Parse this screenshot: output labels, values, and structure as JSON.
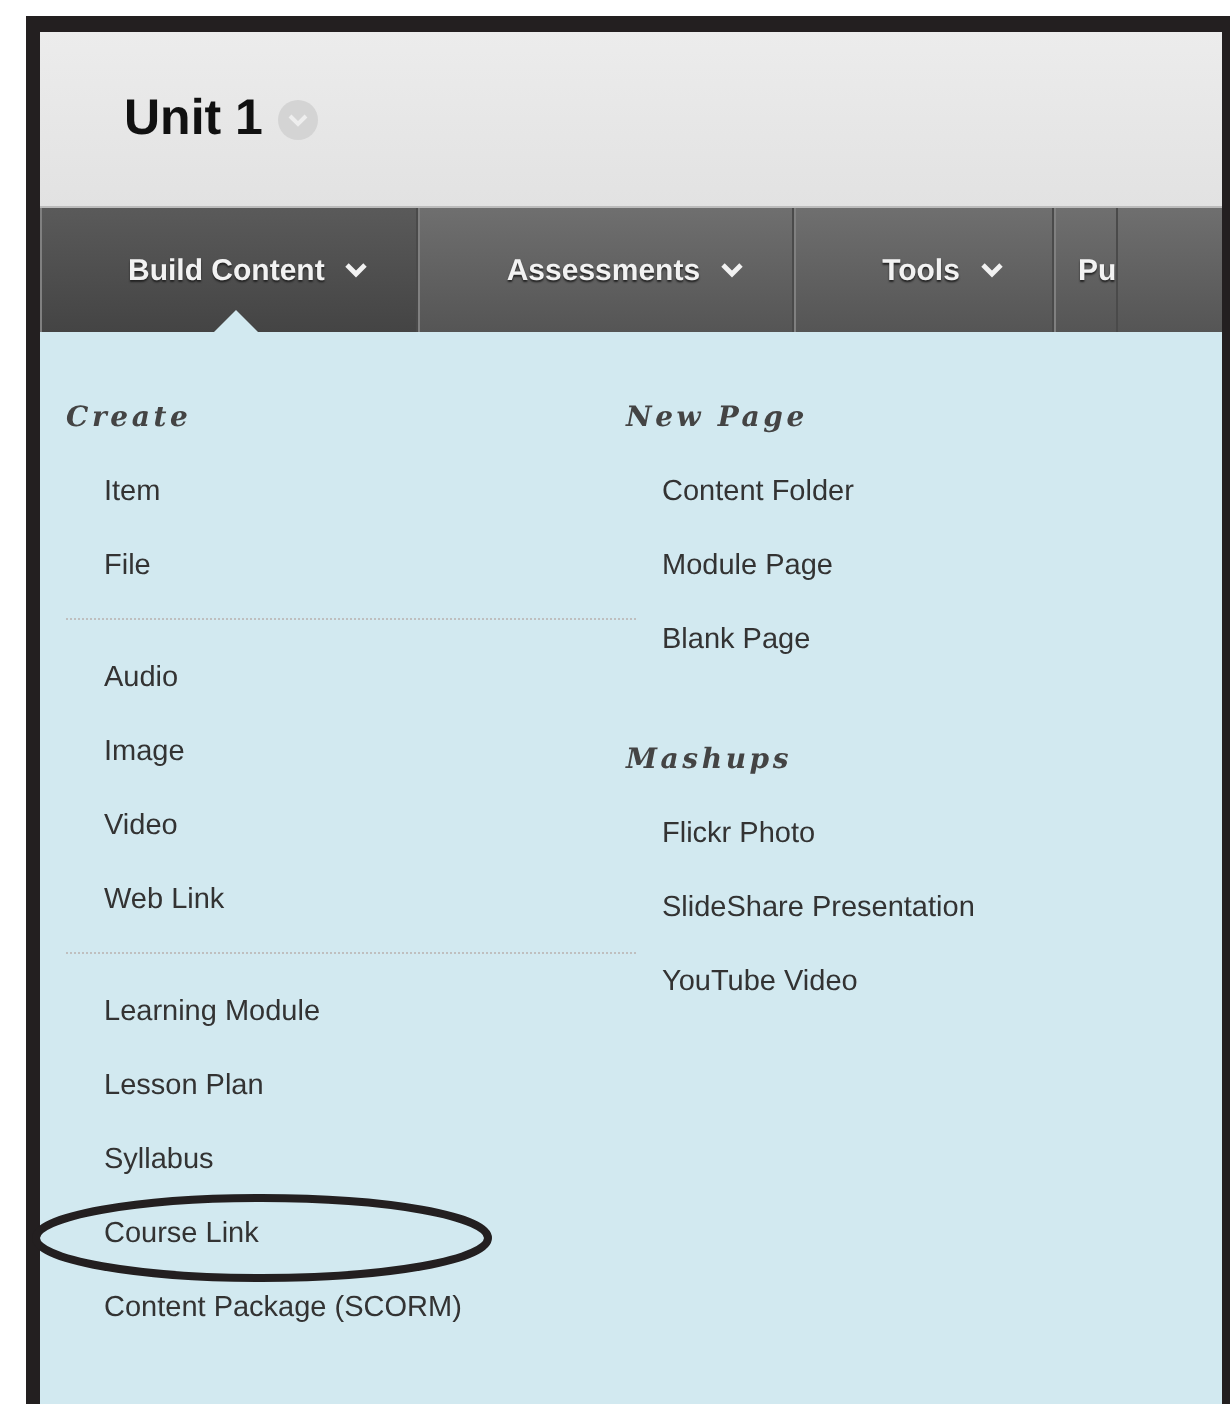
{
  "page_title": "Unit 1",
  "nav_tabs": [
    {
      "label": "Build Content",
      "selected": true,
      "caret": true
    },
    {
      "label": "Assessments",
      "selected": false,
      "caret": true
    },
    {
      "label": "Tools",
      "selected": false,
      "caret": true
    },
    {
      "label": "Pu",
      "selected": false,
      "caret": false
    }
  ],
  "menu": {
    "columns": [
      {
        "sections": [
          {
            "heading": "Create",
            "groups": [
              [
                {
                  "label": "Item",
                  "circled": false
                },
                {
                  "label": "File",
                  "circled": false
                }
              ],
              [
                {
                  "label": "Audio",
                  "circled": false
                },
                {
                  "label": "Image",
                  "circled": false
                },
                {
                  "label": "Video",
                  "circled": false
                },
                {
                  "label": "Web Link",
                  "circled": false
                }
              ],
              [
                {
                  "label": "Learning Module",
                  "circled": false
                },
                {
                  "label": "Lesson Plan",
                  "circled": false
                },
                {
                  "label": "Syllabus",
                  "circled": false
                },
                {
                  "label": "Course Link",
                  "circled": true
                },
                {
                  "label": "Content Package (SCORM)",
                  "circled": false
                }
              ]
            ]
          }
        ]
      },
      {
        "sections": [
          {
            "heading": "New Page",
            "groups": [
              [
                {
                  "label": "Content Folder",
                  "circled": false
                },
                {
                  "label": "Module Page",
                  "circled": false
                },
                {
                  "label": "Blank Page",
                  "circled": false
                }
              ]
            ]
          },
          {
            "heading": "Mashups",
            "groups": [
              [
                {
                  "label": "Flickr Photo",
                  "circled": false
                },
                {
                  "label": "SlideShare Presentation",
                  "circled": false
                },
                {
                  "label": "YouTube Video",
                  "circled": false
                }
              ]
            ]
          }
        ]
      }
    ]
  }
}
